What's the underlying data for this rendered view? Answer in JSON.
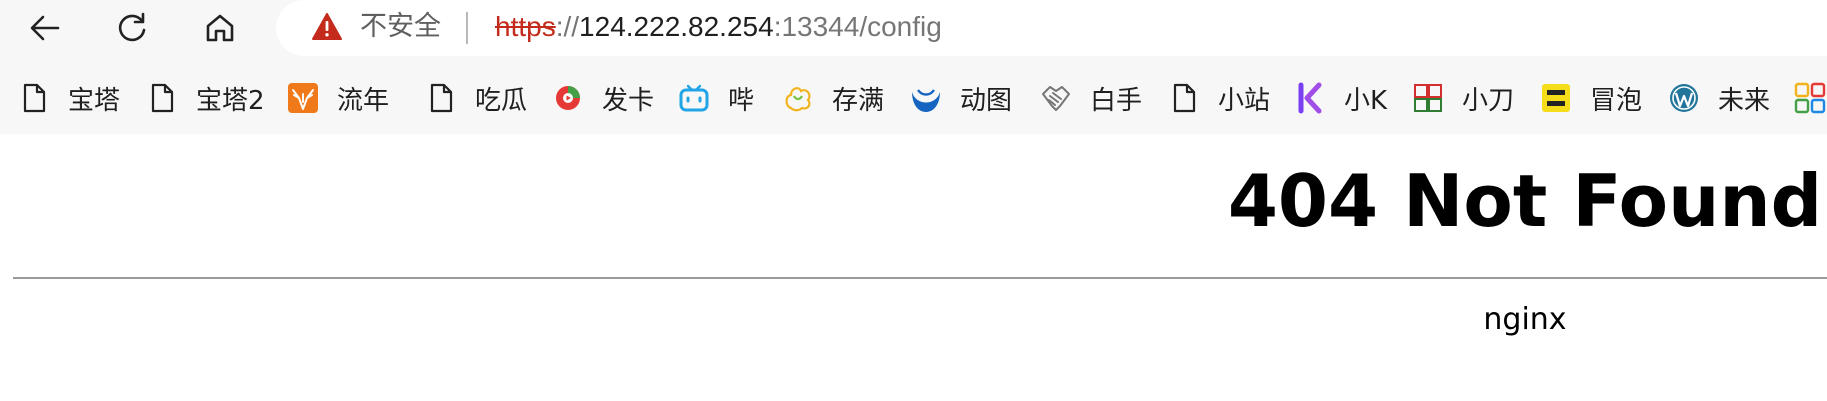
{
  "toolbar": {
    "back_icon": "arrow-left-icon",
    "reload_icon": "reload-icon",
    "home_icon": "home-icon"
  },
  "address_bar": {
    "security_text": "不安全",
    "url_scheme": "https",
    "url_separator": "://",
    "url_host": "124.222.82.254",
    "url_rest": ":13344/config"
  },
  "bookmarks": [
    {
      "label": "宝塔",
      "icon": "page-icon"
    },
    {
      "label": "宝塔2",
      "icon": "page-icon"
    },
    {
      "label": "流年",
      "icon": "deer-icon"
    },
    {
      "label": "吃瓜",
      "icon": "page-icon"
    },
    {
      "label": "发卡",
      "icon": "play-circle-icon"
    },
    {
      "label": "哔",
      "icon": "bilibili-icon"
    },
    {
      "label": "存满",
      "icon": "flower-icon"
    },
    {
      "label": "动图",
      "icon": "wave-icon"
    },
    {
      "label": "白手",
      "icon": "handshake-icon"
    },
    {
      "label": "小站",
      "icon": "page-icon"
    },
    {
      "label": "小K",
      "icon": "k-logo-icon"
    },
    {
      "label": "小刀",
      "icon": "xiaodao-logo-icon"
    },
    {
      "label": "冒泡",
      "icon": "maopao-logo-icon"
    },
    {
      "label": "未来",
      "icon": "wordpress-icon"
    },
    {
      "label": "",
      "icon": "apps-grid-icon"
    }
  ],
  "page": {
    "title": "404 Not Found",
    "server": "nginx"
  },
  "colors": {
    "chrome_bg": "#f7f7f7",
    "warning_red": "#c42b1c",
    "text": "#1f1f1f",
    "muted": "#767676"
  }
}
